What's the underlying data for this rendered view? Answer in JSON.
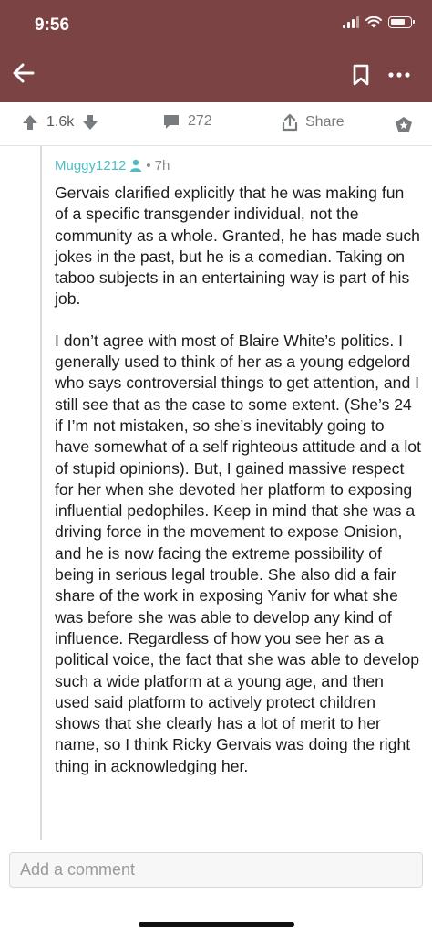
{
  "status_bar": {
    "time": "9:56"
  },
  "nav": {
    "back_icon": "arrow-left-icon",
    "bookmark_icon": "bookmark-icon",
    "more_icon": "more-dots-icon"
  },
  "actions": {
    "vote_count": "1.6k",
    "comment_count": "272",
    "share_label": "Share"
  },
  "comment": {
    "author": "Muggy1212",
    "time": "7h",
    "paragraphs": [
      "Gervais clarified explicitly that he was making fun of a specific transgender individual, not the community as a whole. Granted, he has made such jokes in the past, but he is a comedian. Taking on taboo subjects in an entertaining way is part of his job.",
      "I don’t agree with most of Blaire White’s politics. I generally used to think of her as a young edgelord who says controversial things to get attention, and I still see that as the case to some extent. (She’s 24 if I’m not mistaken, so she’s inevitably going to have somewhat of a self righteous attitude and a lot of stupid opinions). But, I gained massive respect for her when she devoted her platform to exposing influential pedophiles. Keep in mind that she was a driving force in the movement to expose Onision, and he is now facing the extreme possibility of being in serious legal trouble. She also did a fair share of the work in exposing Yaniv for what she was before she was able to develop any kind of influence. Regardless of how you see her as a political voice, the fact that she was able to develop such a wide platform at a young age, and then used said platform to actively protect children shows that she clearly has a lot of merit to her name, so I think Ricky Gervais was doing the right thing in acknowledging her."
    ]
  },
  "composer": {
    "placeholder": "Add a comment"
  },
  "colors": {
    "header": "#7b4343",
    "username": "#4fbcc4",
    "icon_gray": "#787c7e"
  }
}
